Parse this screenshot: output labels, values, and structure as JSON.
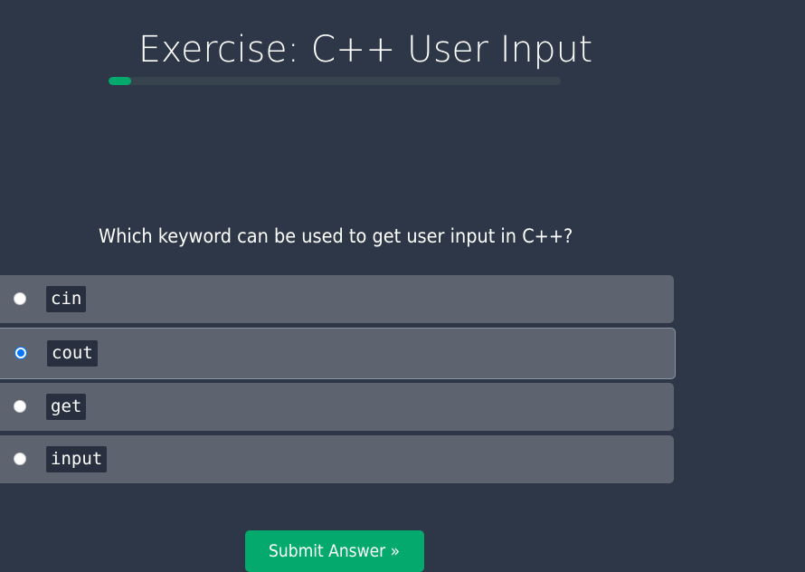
{
  "exercise": {
    "title": "Exercise: C++ User Input",
    "progress_percent": 5
  },
  "question": {
    "text": "Which keyword can be used to get user input in C++?"
  },
  "options": [
    {
      "label": "cin",
      "selected": false
    },
    {
      "label": "cout",
      "selected": true
    },
    {
      "label": "get",
      "selected": false
    },
    {
      "label": "input",
      "selected": false
    }
  ],
  "submit": {
    "label": "Submit Answer »"
  },
  "colors": {
    "background": "#2d3748",
    "accent": "#04aa6d",
    "option_bg": "#5d6470",
    "radio_selected": "#0075ff"
  }
}
